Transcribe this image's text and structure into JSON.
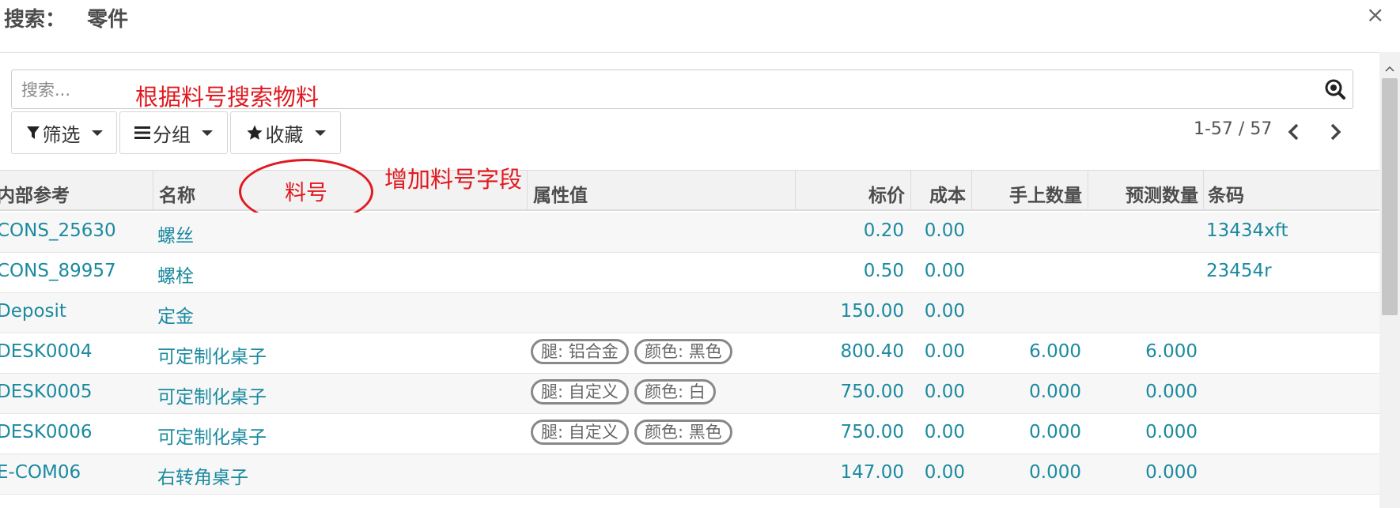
{
  "dialog": {
    "title": "搜索：   零件",
    "close_glyph": "×"
  },
  "search": {
    "placeholder": "搜索..."
  },
  "annotations": {
    "search_note": "根据料号搜索物料",
    "field_note": "增加料号字段",
    "circled_label": "料号"
  },
  "toolbar": {
    "filter_label": "筛选",
    "group_label": "分组",
    "favorite_label": "收藏"
  },
  "pager": {
    "text": "1-57 / 57"
  },
  "columns": {
    "ref": "内部参考",
    "name": "名称",
    "attrs": "属性值",
    "price": "标价",
    "cost": "成本",
    "onhand": "手上数量",
    "forecast": "预测数量",
    "barcode": "条码"
  },
  "rows": [
    {
      "ref": "CONS_25630",
      "name": "螺丝",
      "tags": [],
      "price": "0.20",
      "cost": "0.00",
      "onhand": "",
      "forecast": "",
      "barcode": "13434xft"
    },
    {
      "ref": "CONS_89957",
      "name": "螺栓",
      "tags": [],
      "price": "0.50",
      "cost": "0.00",
      "onhand": "",
      "forecast": "",
      "barcode": "23454r"
    },
    {
      "ref": "Deposit",
      "name": "定金",
      "tags": [],
      "price": "150.00",
      "cost": "0.00",
      "onhand": "",
      "forecast": "",
      "barcode": ""
    },
    {
      "ref": "DESK0004",
      "name": "可定制化桌子",
      "tags": [
        "腿: 铝合金",
        "颜色: 黑色"
      ],
      "price": "800.40",
      "cost": "0.00",
      "onhand": "6.000",
      "forecast": "6.000",
      "barcode": ""
    },
    {
      "ref": "DESK0005",
      "name": "可定制化桌子",
      "tags": [
        "腿: 自定义",
        "颜色: 白"
      ],
      "price": "750.00",
      "cost": "0.00",
      "onhand": "0.000",
      "forecast": "0.000",
      "barcode": ""
    },
    {
      "ref": "DESK0006",
      "name": "可定制化桌子",
      "tags": [
        "腿: 自定义",
        "颜色: 黑色"
      ],
      "price": "750.00",
      "cost": "0.00",
      "onhand": "0.000",
      "forecast": "0.000",
      "barcode": ""
    },
    {
      "ref": "E-COM06",
      "name": "右转角桌子",
      "tags": [],
      "price": "147.00",
      "cost": "0.00",
      "onhand": "0.000",
      "forecast": "0.000",
      "barcode": ""
    }
  ],
  "icons": {
    "filter": "filter-icon",
    "group": "list-icon",
    "favorite": "star-icon",
    "search": "search-icon",
    "prev": "chevron-left-icon",
    "next": "chevron-right-icon"
  }
}
